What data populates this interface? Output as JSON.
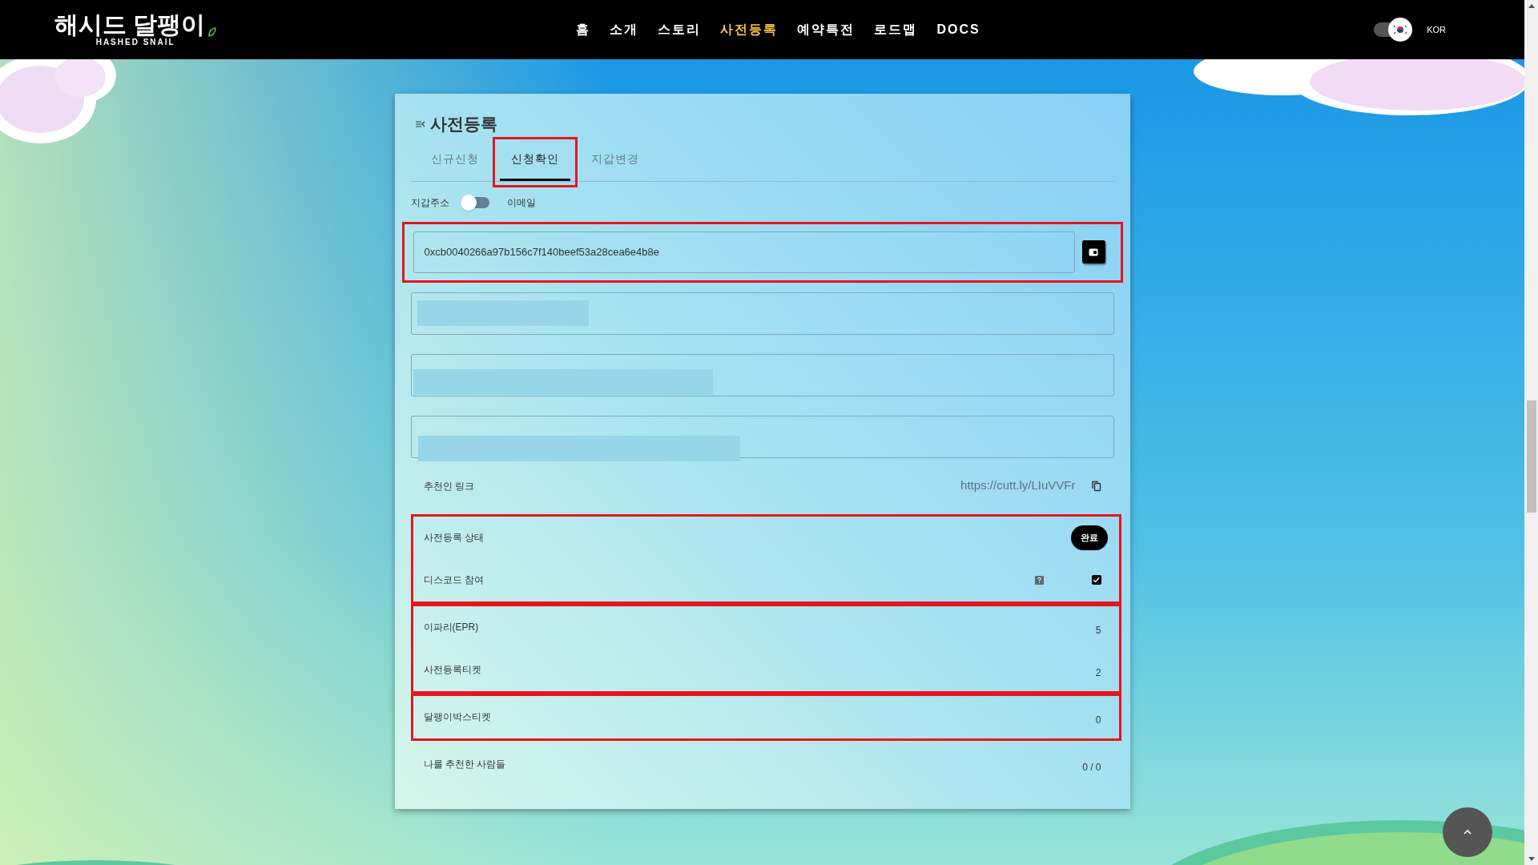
{
  "header": {
    "logo": {
      "title": "해시드 달팽이",
      "subtitle": "HASHED SNAIL"
    },
    "nav": [
      {
        "label": "홈",
        "selected": false
      },
      {
        "label": "소개",
        "selected": false
      },
      {
        "label": "스토리",
        "selected": false
      },
      {
        "label": "사전등록",
        "selected": true
      },
      {
        "label": "예약특전",
        "selected": false
      },
      {
        "label": "로드맵",
        "selected": false
      },
      {
        "label": "DOCS",
        "selected": false
      }
    ],
    "language": "KOR"
  },
  "card": {
    "title": "사전등록",
    "tabs": [
      {
        "label": "신규신청",
        "selected": false,
        "highlighted": false
      },
      {
        "label": "신청확인",
        "selected": true,
        "highlighted": true
      },
      {
        "label": "지갑변경",
        "selected": false,
        "highlighted": false
      }
    ],
    "mode_toggle": {
      "left_label": "지갑주소",
      "right_label": "이메일",
      "on": false
    },
    "wallet": {
      "value": "0xcb0040266a97b156c7f140beef53a28cea6e4b8e",
      "highlighted": true
    },
    "hidden_fields": [
      {
        "redacted": true
      },
      {
        "redacted": true
      },
      {
        "redacted": true
      }
    ],
    "referral": {
      "label": "추천인 링크",
      "link": "https://cutt.ly/LIuVVFr"
    },
    "groups": [
      {
        "highlighted": true,
        "rows": [
          {
            "kind": "badge",
            "label": "사전등록 상태",
            "badge": "완료"
          },
          {
            "kind": "checkbox",
            "label": "디스코드 참여",
            "checked": true
          }
        ]
      },
      {
        "highlighted": true,
        "rows": [
          {
            "kind": "value",
            "label": "이파리(EPR)",
            "value": "5"
          },
          {
            "kind": "value",
            "label": "사전등록티켓",
            "value": "2"
          }
        ]
      },
      {
        "highlighted": true,
        "rows": [
          {
            "kind": "value",
            "label": "달팽이박스티켓",
            "value": "0"
          }
        ]
      },
      {
        "highlighted": false,
        "rows": [
          {
            "kind": "value",
            "label": "나를 추천한 사람들",
            "value": "0 / 0"
          }
        ]
      }
    ]
  }
}
